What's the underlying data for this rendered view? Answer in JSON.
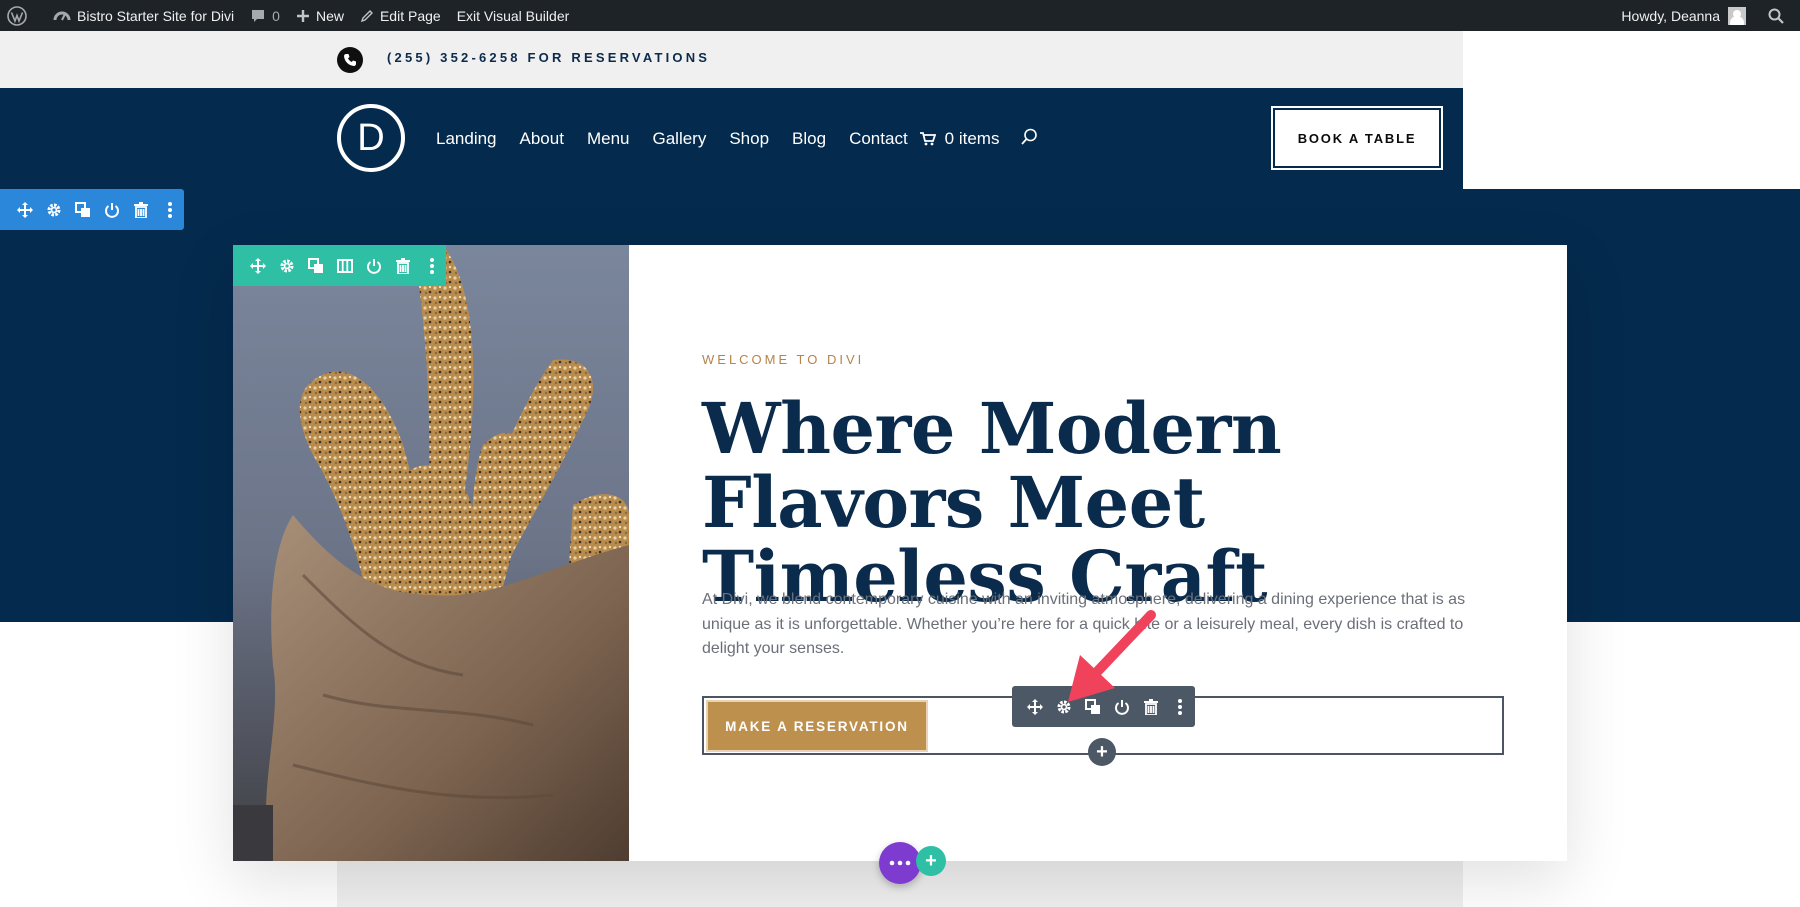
{
  "admin_bar": {
    "wp_logo": "wordpress-icon",
    "site_name": "Bistro Starter Site for Divi",
    "comments_count": "0",
    "new_label": "New",
    "edit_page_label": "Edit Page",
    "exit_builder_label": "Exit Visual Builder",
    "howdy_label": "Howdy, Deanna",
    "search_icon": "search-icon"
  },
  "topbar": {
    "phone_text": "(255) 352-6258 FOR RESERVATIONS"
  },
  "header": {
    "logo_letter": "D",
    "nav": [
      {
        "label": "Landing"
      },
      {
        "label": "About"
      },
      {
        "label": "Menu"
      },
      {
        "label": "Gallery"
      },
      {
        "label": "Shop"
      },
      {
        "label": "Blog"
      },
      {
        "label": "Contact"
      }
    ],
    "cart_label": "0 items",
    "book_button": "BOOK A TABLE"
  },
  "hero": {
    "eyebrow": "WELCOME TO DIVI",
    "headline": "Where Modern Flavors Meet Timeless Craft",
    "body": "At Divi, we blend contemporary cuisine with an inviting atmosphere, delivering a dining experience that is as unique as it is unforgettable. Whether you’re here for a quick bite or a leisurely meal, every dish is crafted to delight your senses.",
    "reserve_button": "MAKE A RESERVATION"
  },
  "builder": {
    "section_tools": [
      "move-icon",
      "gear-icon",
      "duplicate-icon",
      "power-icon",
      "trash-icon",
      "more-icon"
    ],
    "row_tools": [
      "move-icon",
      "gear-icon",
      "duplicate-icon",
      "columns-icon",
      "power-icon",
      "trash-icon",
      "more-icon"
    ],
    "module_tools": [
      "move-icon",
      "gear-icon",
      "duplicate-icon",
      "power-icon",
      "trash-icon",
      "more-icon"
    ],
    "add_module_symbol": "+",
    "add_section_symbol": "+"
  },
  "colors": {
    "navy": "#042a4d",
    "section_blue": "#2b87da",
    "row_green": "#2ebfa5",
    "module_grey": "#4c5866",
    "gold": "#be904d",
    "purple": "#7e3bd0",
    "arrow_red": "#f0425a"
  }
}
